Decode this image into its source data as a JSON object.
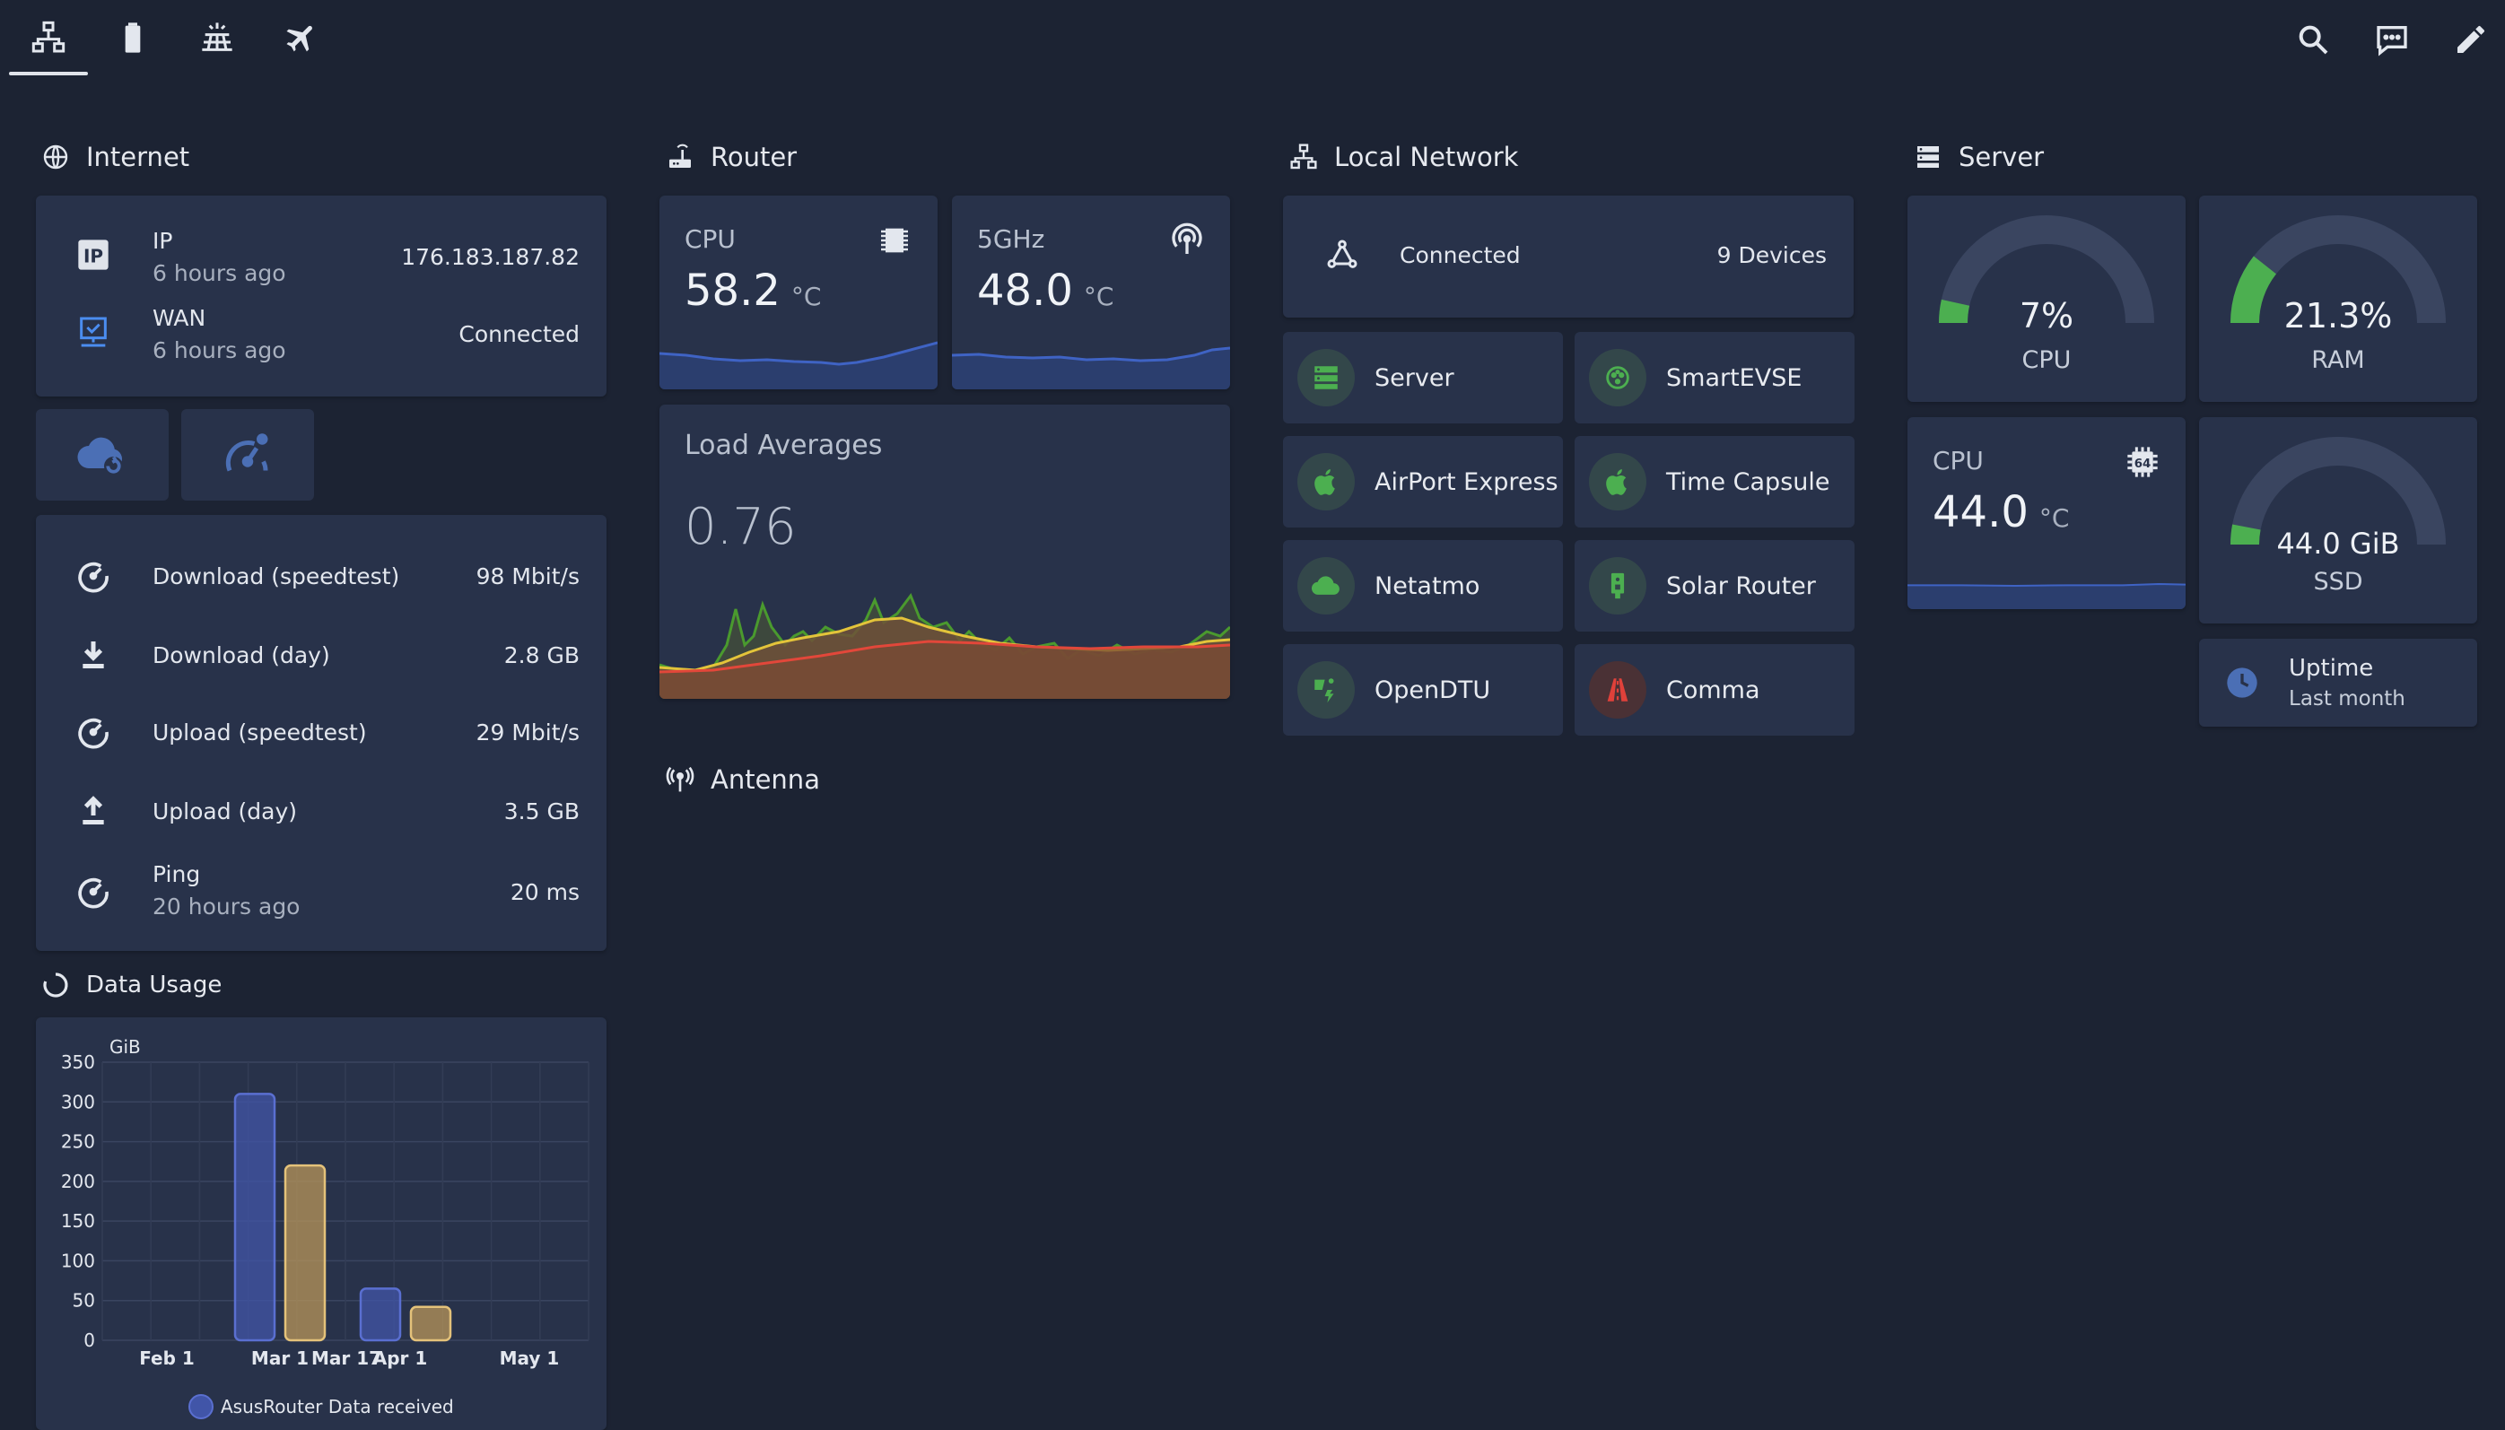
{
  "tabs": [
    {
      "name": "network-icon",
      "active": true
    },
    {
      "name": "battery-icon",
      "active": false
    },
    {
      "name": "solar-panel-icon",
      "active": false
    },
    {
      "name": "airplane-icon",
      "active": false
    }
  ],
  "actions": [
    "search-icon",
    "chat-icon",
    "pencil-icon"
  ],
  "colors": {
    "background": "#1c2333",
    "card": "#28324a",
    "accent_green": "#4caf50",
    "spark_blue": "#3f5eb5",
    "usage_received": "#4155a8",
    "usage_sent": "#b8965a"
  },
  "internet": {
    "title": "Internet",
    "rows": [
      {
        "icon": "ip-icon",
        "name": "IP",
        "sub": "6 hours ago",
        "value": "176.183.187.82"
      },
      {
        "icon": "wan-icon",
        "name": "WAN",
        "sub": "6 hours ago",
        "value": "Connected"
      }
    ],
    "buttons": [
      "cloud-sync-icon",
      "speedtest-icon"
    ],
    "stats": [
      {
        "icon": "gauge-icon",
        "name": "Download (speedtest)",
        "value": "98 Mbit/s"
      },
      {
        "icon": "download-icon",
        "name": "Download (day)",
        "value": "2.8 GB"
      },
      {
        "icon": "gauge-icon",
        "name": "Upload (speedtest)",
        "value": "29 Mbit/s"
      },
      {
        "icon": "upload-icon",
        "name": "Upload (day)",
        "value": "3.5 GB"
      },
      {
        "icon": "gauge-icon",
        "name": "Ping",
        "sub": "20 hours ago",
        "value": "20 ms"
      }
    ]
  },
  "data_usage": {
    "title": "Data Usage",
    "unit": "GiB",
    "legend": "AsusRouter Data received"
  },
  "chart_data": {
    "type": "bar",
    "ylabel": "GiB",
    "ylim": [
      0,
      350
    ],
    "yticks": [
      "350",
      "300",
      "250",
      "200",
      "150",
      "100",
      "50",
      "0"
    ],
    "xticks": [
      "Feb 1",
      "Mar 1",
      "Mar 17",
      "Apr 1",
      "May 1"
    ],
    "series": [
      {
        "name": "AsusRouter Data received",
        "color": "#4155a8",
        "values": [
          310,
          65
        ]
      },
      {
        "color": "#b8965a",
        "values": [
          220,
          42
        ]
      }
    ],
    "categories": [
      "Mar",
      "Apr"
    ],
    "grid": true,
    "legend_position": "bottom"
  },
  "router": {
    "title": "Router",
    "cpu": {
      "name": "CPU",
      "value": "58.2",
      "unit": "°C"
    },
    "wifi": {
      "name": "5GHz",
      "value": "48.0",
      "unit": "°C"
    },
    "load": {
      "title": "Load Averages",
      "value": "0.76"
    }
  },
  "antenna": {
    "title": "Antenna"
  },
  "local_network": {
    "title": "Local Network",
    "connected_label": "Connected",
    "devices": "9 Devices",
    "tiles": [
      {
        "label": "Server",
        "icon": "server-icon",
        "color": "#4caf50"
      },
      {
        "label": "SmartEVSE",
        "icon": "ev-plug-icon",
        "color": "#4caf50"
      },
      {
        "label": "AirPort Express",
        "icon": "apple-icon",
        "color": "#4caf50"
      },
      {
        "label": "Time Capsule",
        "icon": "apple-icon",
        "color": "#4caf50"
      },
      {
        "label": "Netatmo",
        "icon": "cloud-icon",
        "color": "#4caf50"
      },
      {
        "label": "Solar Router",
        "icon": "solar-router-icon",
        "color": "#4caf50"
      },
      {
        "label": "OpenDTU",
        "icon": "solar-power-icon",
        "color": "#4caf50"
      },
      {
        "label": "Comma",
        "icon": "road-icon",
        "color": "#e0413a"
      }
    ]
  },
  "server": {
    "title": "Server",
    "cpu_gauge": {
      "value": "7%",
      "label": "CPU",
      "fraction": 0.07
    },
    "ram_gauge": {
      "value": "21.3%",
      "label": "RAM",
      "fraction": 0.213
    },
    "ssd_gauge": {
      "value": "44.0 GiB",
      "label": "SSD",
      "fraction": 0.06
    },
    "cpu_temp": {
      "name": "CPU",
      "value": "44.0",
      "unit": "°C"
    },
    "uptime": {
      "name": "Uptime",
      "sub": "Last month"
    }
  }
}
